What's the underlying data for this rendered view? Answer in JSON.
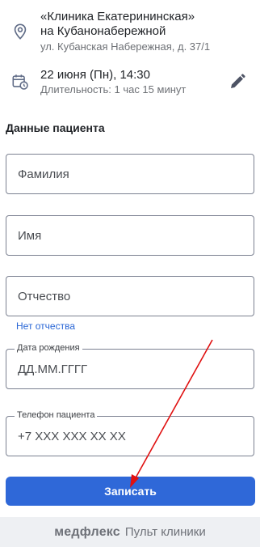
{
  "clinic": {
    "name_line1": "«Клиника Екатерининская»",
    "name_line2": "на Кубанонабережной",
    "address": "ул. Кубанская Набережная, д. 37/1",
    "icon": "location-pin-icon"
  },
  "appointment": {
    "datetime": "22 июня (Пн), 14:30",
    "duration": "Длительность: 1 час 15 минут",
    "icon": "calendar-clock-icon",
    "edit_icon": "pencil-icon"
  },
  "patient": {
    "title": "Данные пациента",
    "last_name_placeholder": "Фамилия",
    "first_name_placeholder": "Имя",
    "middle_name_placeholder": "Отчество",
    "no_middle_name_link": "Нет отчества",
    "birth_date_label": "Дата рождения",
    "birth_date_placeholder": "ДД.ММ.ГГГГ",
    "phone_label": "Телефон пациента",
    "phone_placeholder": "+7 XXX XXX XX XX"
  },
  "actions": {
    "submit_label": "Записать"
  },
  "footer": {
    "brand": "медфлекс",
    "subtitle": "Пульт клиники"
  },
  "colors": {
    "primary": "#2f68d8",
    "link": "#2a67d6",
    "annotation_arrow": "#e01010"
  }
}
